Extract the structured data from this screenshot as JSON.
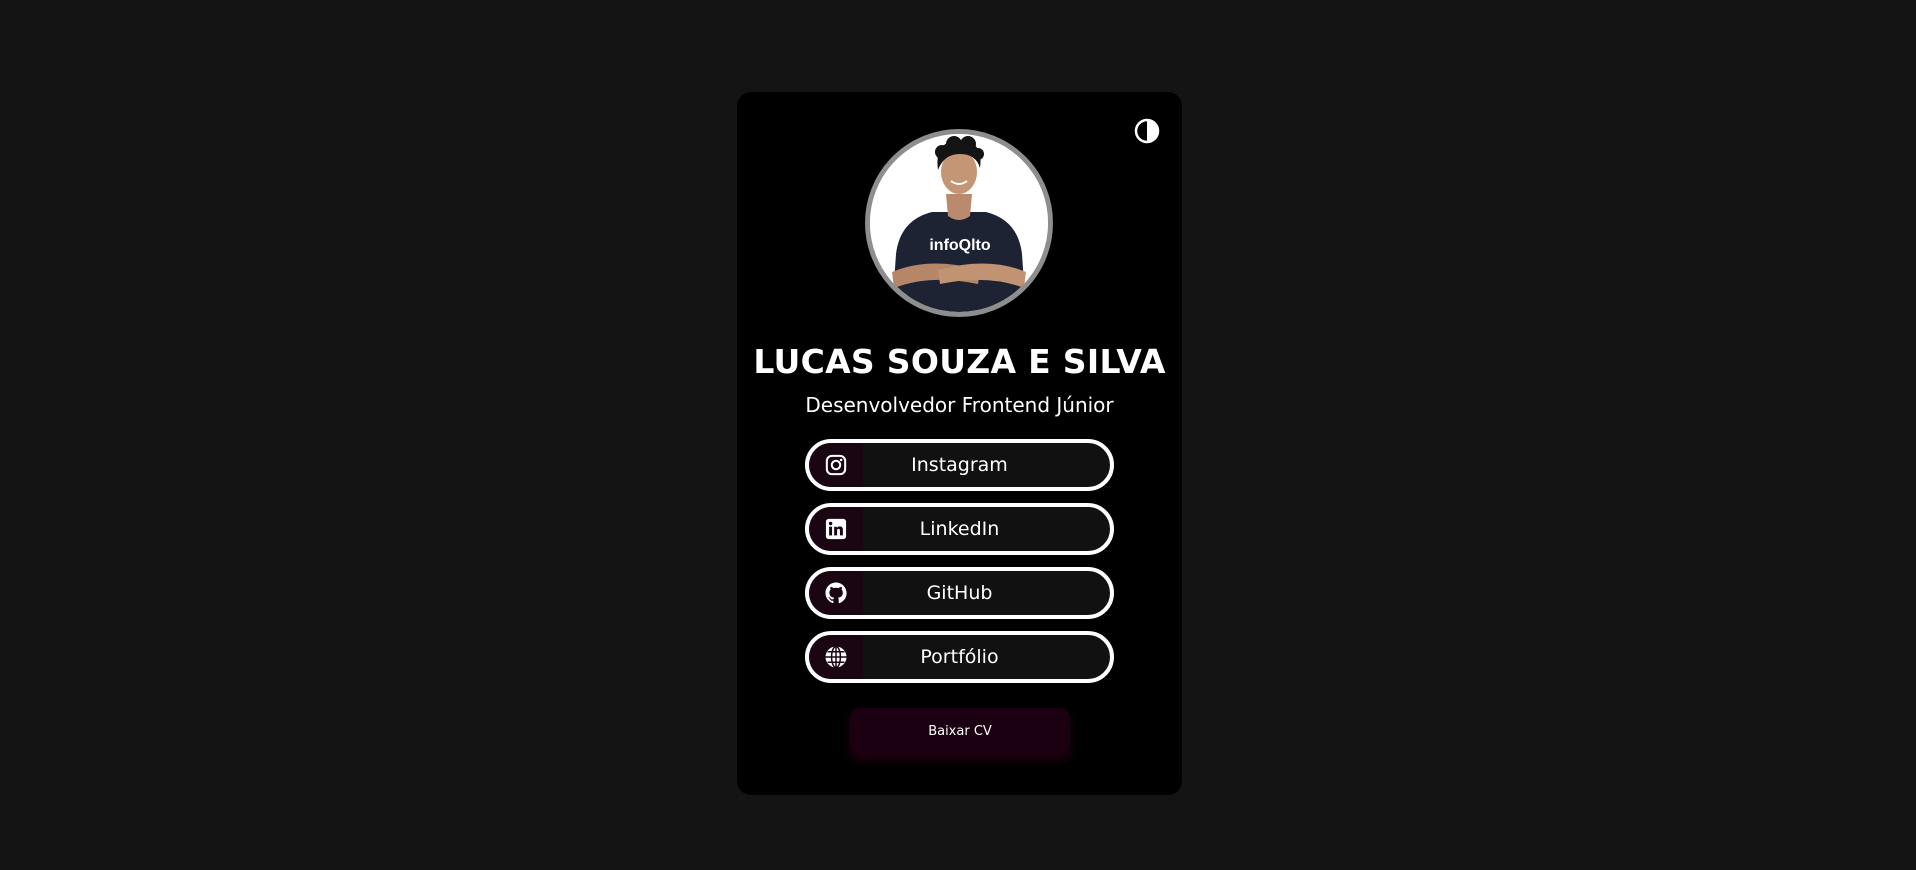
{
  "profile": {
    "name": "LUCAS SOUZA E SILVA",
    "role": "Desenvolvedor Frontend Júnior",
    "shirt_text": "infoQlto"
  },
  "links": [
    {
      "label": "Instagram",
      "icon": "instagram-icon"
    },
    {
      "label": "LinkedIn",
      "icon": "linkedin-icon"
    },
    {
      "label": "GitHub",
      "icon": "github-icon"
    },
    {
      "label": "Portfólio",
      "icon": "globe-icon"
    }
  ],
  "cv_button": {
    "label": "Baixar CV"
  },
  "theme_toggle": {
    "icon": "contrast-icon"
  },
  "colors": {
    "page_background": "#141414",
    "card_background": "#000000",
    "link_border": "#ffffff",
    "icon_circle": "#1a0612",
    "cv_button": "#1a0010",
    "avatar_border": "#8e8e8e"
  }
}
